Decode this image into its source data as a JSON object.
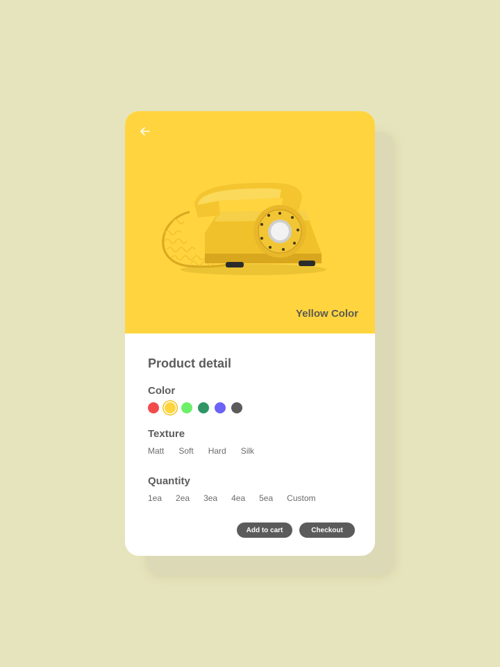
{
  "product": {
    "image_alt": "Yellow rotary telephone",
    "color_name": "Yellow Color"
  },
  "details": {
    "title": "Product detail",
    "color_label": "Color",
    "colors": [
      {
        "name": "red",
        "hex": "#f24a4a"
      },
      {
        "name": "yellow",
        "hex": "#ffd43f",
        "selected": true
      },
      {
        "name": "green",
        "hex": "#6cf06a"
      },
      {
        "name": "teal",
        "hex": "#2f9565"
      },
      {
        "name": "violet",
        "hex": "#6b63f6"
      },
      {
        "name": "dark-gray",
        "hex": "#5b5b5b"
      }
    ],
    "texture_label": "Texture",
    "textures": [
      "Matt",
      "Soft",
      "Hard",
      "Silk"
    ],
    "quantity_label": "Quantity",
    "quantities": [
      "1ea",
      "2ea",
      "3ea",
      "4ea",
      "5ea",
      "Custom"
    ]
  },
  "actions": {
    "add_to_cart": "Add to cart",
    "checkout": "Checkout"
  },
  "theme": {
    "background": "#e6e4bc",
    "hero": "#ffd43f",
    "button": "#5b5b5b"
  }
}
